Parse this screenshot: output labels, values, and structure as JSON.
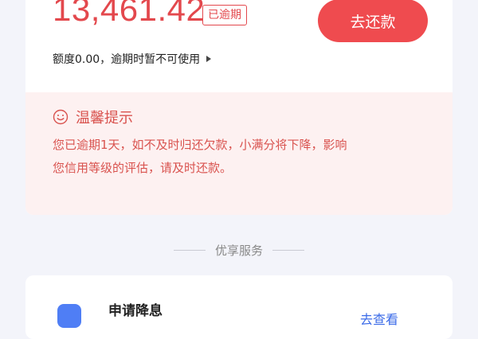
{
  "account": {
    "amount": "13,461.42",
    "status_badge": "已逾期",
    "repay_button": "去还款",
    "quota_text": "额度0.00，逾期时暂不可使用"
  },
  "tip": {
    "title": "温馨提示",
    "line1": "您已逾期1天，如不及时归还欠款，小满分将下降，影响",
    "line2": "您信用等级的评估，请及时还款。"
  },
  "services": {
    "section_title": "优享服务",
    "items": [
      {
        "title": "申请降息",
        "link": "去查看"
      }
    ]
  },
  "colors": {
    "accent_red": "#ef4b4f",
    "tip_bg": "#fdf1f1",
    "link_blue": "#3b6be8"
  },
  "icons": [
    "smile-icon",
    "chevron-right-icon",
    "service-icon"
  ]
}
